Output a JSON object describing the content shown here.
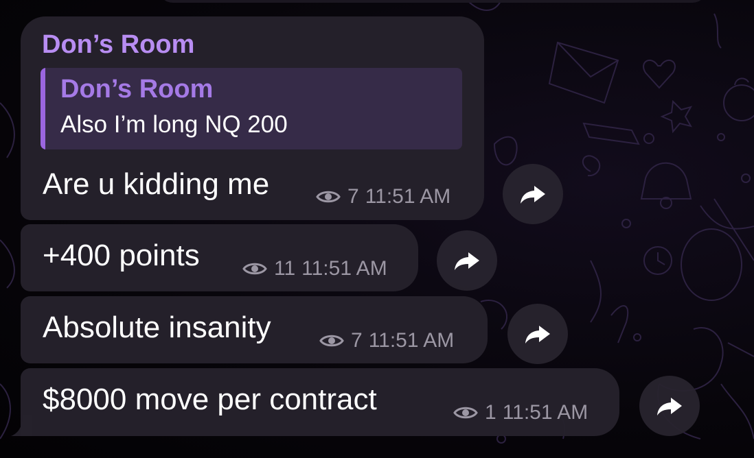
{
  "group": {
    "sender_name": "Don’s Room",
    "reply": {
      "sender_name": "Don’s Room",
      "text": "Also I’m long NQ 200"
    }
  },
  "messages": [
    {
      "text": "Are u kidding me",
      "views": "7",
      "time": "11:51 AM"
    },
    {
      "text": "+400 points",
      "views": "11",
      "time": "11:51 AM"
    },
    {
      "text": "Absolute insanity",
      "views": "7",
      "time": "11:51 AM"
    },
    {
      "text": "$8000 move per contract",
      "views": "1",
      "time": "11:51 AM"
    }
  ],
  "icons": {
    "views": "eye-icon",
    "forward": "share-arrow-icon"
  },
  "colors": {
    "sender": "#b88df2",
    "reply_accent": "#9b66e0",
    "bubble": "#25212b",
    "meta": "#9c97a4"
  }
}
